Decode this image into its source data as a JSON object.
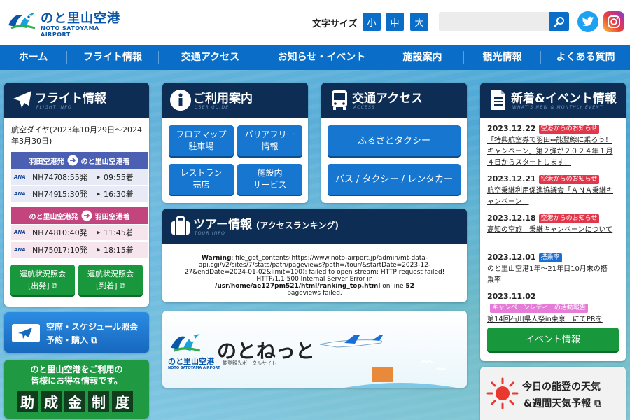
{
  "header": {
    "logo_title": "のと里山空港",
    "logo_sub": "NOTO SATOYAMA AIRPORT",
    "fontsize_label": "文字サイズ",
    "fontsize_options": [
      "小",
      "中",
      "大"
    ],
    "search_placeholder": ""
  },
  "nav": [
    "ホーム",
    "フライト情報",
    "交通アクセス",
    "お知らせ・イベント",
    "施設案内",
    "観光情報",
    "よくある質問"
  ],
  "flight": {
    "title": "フライト情報",
    "title_en": "FLIGHT INFO",
    "period": "航空ダイヤ(2023年10月29日～2024年3月30日)",
    "route1": {
      "from": "羽田空港発",
      "to": "のと里山空港着",
      "color": "#4b5fb3"
    },
    "route1_flights": [
      {
        "airline": "ANA",
        "no": "NH747",
        "dep": "08:55発",
        "arr": "09:55着"
      },
      {
        "airline": "ANA",
        "no": "NH749",
        "dep": "15:30発",
        "arr": "16:30着"
      }
    ],
    "route2": {
      "from": "のと里山空港発",
      "to": "羽田空港着",
      "color": "#c2457e"
    },
    "route2_flights": [
      {
        "airline": "ANA",
        "no": "NH748",
        "dep": "10:40発",
        "arr": "11:45着"
      },
      {
        "airline": "ANA",
        "no": "NH750",
        "dep": "17:10発",
        "arr": "18:15着"
      }
    ],
    "status_dep": [
      "運航状況照会",
      "[出発]"
    ],
    "status_arr": [
      "運航状況照会",
      "[到着]"
    ]
  },
  "guide": {
    "title": "ご利用案内",
    "title_en": "USER GUIDE",
    "buttons": [
      [
        "フロアマップ",
        "駐車場"
      ],
      [
        "バリアフリー",
        "情報"
      ],
      [
        "レストラン",
        "売店"
      ],
      [
        "施設内",
        "サービス"
      ]
    ]
  },
  "access": {
    "title": "交通アクセス",
    "title_en": "ACCESS",
    "buttons": [
      "ふるさとタクシー",
      "バス / タクシー / レンタカー"
    ]
  },
  "tour": {
    "title": "ツアー情報",
    "subtitle": "(アクセスランキング)",
    "title_en": "TOUR INFO",
    "warning_label": "Warning",
    "warning_line1": ": file_get_contents(https://www.noto-airport.jp/admin/mt-data-",
    "warning_line2": "api.cgi/v2/sites/7/stats/path/pageviews?path=/tour/&startDate=2023-12-",
    "warning_line3": "27&endDate=2024-01-02&limit=100): failed to open stream: HTTP request failed!",
    "warning_line4": "HTTP/1.1 500 Internal Server Error in",
    "warning_path": "/usr/home/ae127pm521/html/ranking_top.html",
    "warning_on_line": " on line ",
    "warning_line_no": "52",
    "warning_line5": "pageviews failed."
  },
  "banner": {
    "logo_title": "のと里山空港",
    "logo_sub": "NOTO SATOYAMA AIRPORT",
    "portal_name": "のとねっと",
    "portal_sub": "能登観光ポータルサイト"
  },
  "news": {
    "title": "新着&イベント情報",
    "title_en": "WHAT'S NEW & MONTHLY EVENT",
    "items": [
      {
        "date": "2023.12.22",
        "badge": "空港からのお知らせ",
        "badge_color": "red",
        "text": "「特典航空券で羽田⇔能登線に乗ろう！キャンペーン」第２弾が２０２４年１月４日からスタートします！"
      },
      {
        "date": "2023.12.21",
        "badge": "空港からのお知らせ",
        "badge_color": "red",
        "text": "航空乗継利用促進協議会「ＡＮＡ乗継キャンペーン」"
      },
      {
        "date": "2023.12.18",
        "badge": "空港からのお知らせ",
        "badge_color": "red",
        "text": "高知の空旅　乗継キャンペーンについて"
      },
      {
        "date": "2023.12.01",
        "badge": "搭乗率",
        "badge_color": "blue",
        "text": "のと里山空港1年～21年目10月末の搭乗率"
      },
      {
        "date": "2023.11.02",
        "badge": "キャンペーンレディーの活動報告",
        "badge_color": "pink",
        "text": "第14回石川県人祭in東京　にてPRを"
      }
    ],
    "event_button": "イベント情報"
  },
  "schedule_banner": {
    "line1": "空席・スケジュール照会",
    "line2": "予約・購入"
  },
  "subsidy": {
    "line1": "のと里山空港をご利用の",
    "line2": "皆様にお得な情報です。",
    "big": [
      "助",
      "成",
      "金",
      "制",
      "度"
    ]
  },
  "weather": {
    "line1": "今日の能登の天気",
    "line2": "&週間天気予報"
  },
  "colors": {
    "nav": "#0a6ec8",
    "panel_head": "#0d2d55",
    "button_blue": "#1676d0",
    "button_green": "#18973c"
  }
}
